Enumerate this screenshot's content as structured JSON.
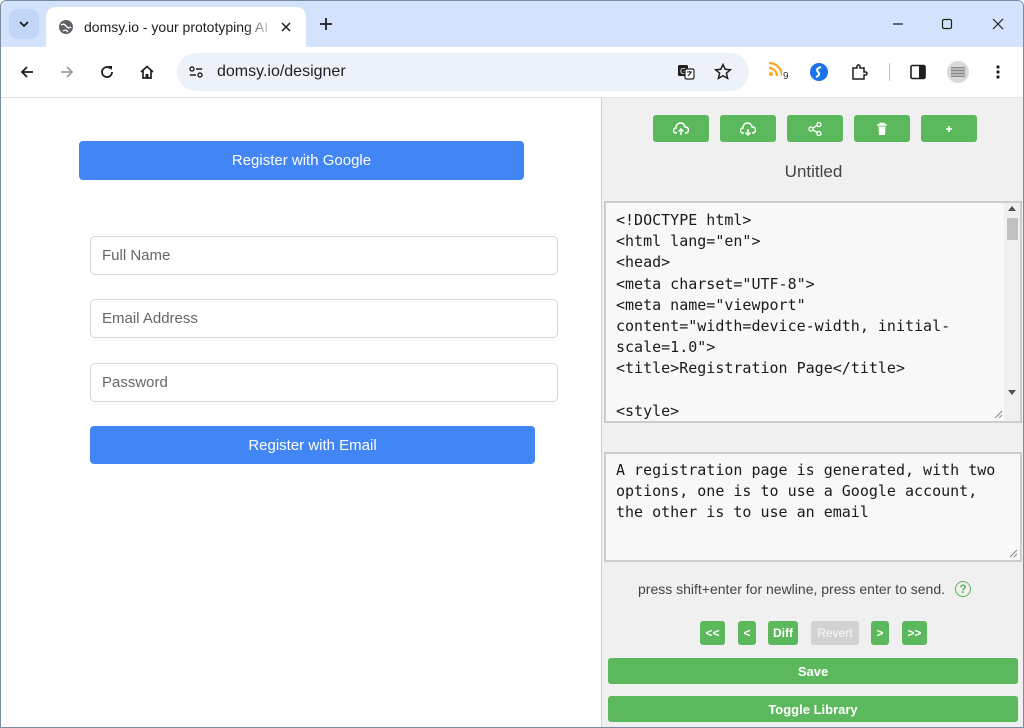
{
  "browser": {
    "tab_title": "domsy.io - your prototyping AI",
    "new_tab_label": "+",
    "url": "domsy.io/designer",
    "extension_badge": "9"
  },
  "preview": {
    "google_button": "Register with Google",
    "full_name_placeholder": "Full Name",
    "email_placeholder": "Email Address",
    "password_placeholder": "Password",
    "email_button": "Register with Email"
  },
  "panel": {
    "toolbar_icons": [
      "upload-cloud-icon",
      "download-cloud-icon",
      "share-icon",
      "trash-icon",
      "plus-icon"
    ],
    "doc_title": "Untitled",
    "code_lines": [
      "<!DOCTYPE html>",
      "<html lang=\"en\">",
      "<head>",
      "<meta charset=\"UTF-8\">",
      "<meta name=\"viewport\"",
      "content=\"width=device-width, initial-",
      "scale=1.0\">",
      "<title>Registration Page</title>",
      "",
      "<style>"
    ],
    "prompt_text": "A registration page is generated, with two options, one is to use a Google account, the other is to use an email",
    "hint": "press shift+enter for newline, press enter to send.",
    "help_label": "?",
    "nav": {
      "first": "<<",
      "prev": "<",
      "diff": "Diff",
      "revert": "Revert",
      "next": ">",
      "last": ">>"
    },
    "save_label": "Save",
    "toggle_library_label": "Toggle Library"
  },
  "colors": {
    "accent_blue": "#4285f4",
    "accent_green": "#5cb85c",
    "tab_strip": "#d3e3fd"
  }
}
